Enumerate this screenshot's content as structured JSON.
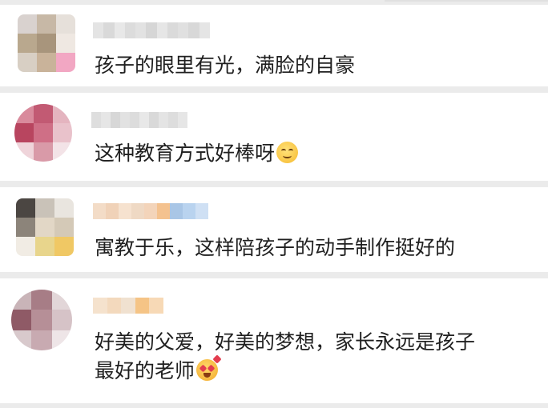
{
  "comments": [
    {
      "text": "孩子的眼里有光，满脸的自豪",
      "emoji": "",
      "avatar_colors": [
        "#d9d2cf",
        "#c7b8a6",
        "#e6e0da",
        "#b9a88e",
        "#a8957c",
        "#efe8e2",
        "#d8cfc4",
        "#c9b39a",
        "#f2a7c3"
      ],
      "name_colors": [
        "#e4e4e4",
        "#d9d9d9",
        "#e8e8e8",
        "#dcdcdc",
        "#e2e2e2",
        "#d6d6d6",
        "#e6e6e6",
        "#dadada",
        "#e0e0e0",
        "#d8d8d8",
        "#e5e5e5"
      ]
    },
    {
      "text": "这种教育方式好棒呀",
      "emoji": "smiling-face-icon",
      "avatar_colors": [
        "#d98a9c",
        "#c25a73",
        "#e4b4bf",
        "#b8455f",
        "#cf6f86",
        "#e9c2cb",
        "#efd4da",
        "#d99aa8",
        "#f3e3e7"
      ],
      "name_colors": [
        "#dedede",
        "#e6e6e6",
        "#d7d7d7",
        "#e2e2e2",
        "#dcdcdc",
        "#e8e8e8",
        "#d9d9d9",
        "#e4e4e4",
        "#dddddd",
        "#e6e6e6"
      ]
    },
    {
      "text": "寓教于乐，这样陪孩子的动手制作挺好的",
      "emoji": "",
      "avatar_colors": [
        "#4b4642",
        "#c9c2b8",
        "#e9e5df",
        "#8c847a",
        "#e2d7c6",
        "#d4c9b7",
        "#f1ece4",
        "#e8d58c",
        "#f0c864"
      ],
      "name_colors": [
        "#f3dcc7",
        "#f0d2b8",
        "#f6e2cf",
        "#efd9c4",
        "#f3d4ba",
        "#f4c28f",
        "#a9c6e6",
        "#b9d3ef",
        "#cfe0f4"
      ]
    },
    {
      "text": "好美的父爱，好美的梦想，家长永远是孩子\n最好的老师",
      "emoji": "heart-eyes-face-icon",
      "avatar_colors": [
        "#c9b4b8",
        "#a77d86",
        "#e2d6d8",
        "#8f5a66",
        "#b68f97",
        "#d6c3c7",
        "#d8c9cc",
        "#c8aab1",
        "#eee5e7"
      ],
      "name_colors": [
        "#f5e2cd",
        "#f3d9bd",
        "#f0e1d0",
        "#f5c486",
        "#f7d9b6"
      ]
    }
  ]
}
